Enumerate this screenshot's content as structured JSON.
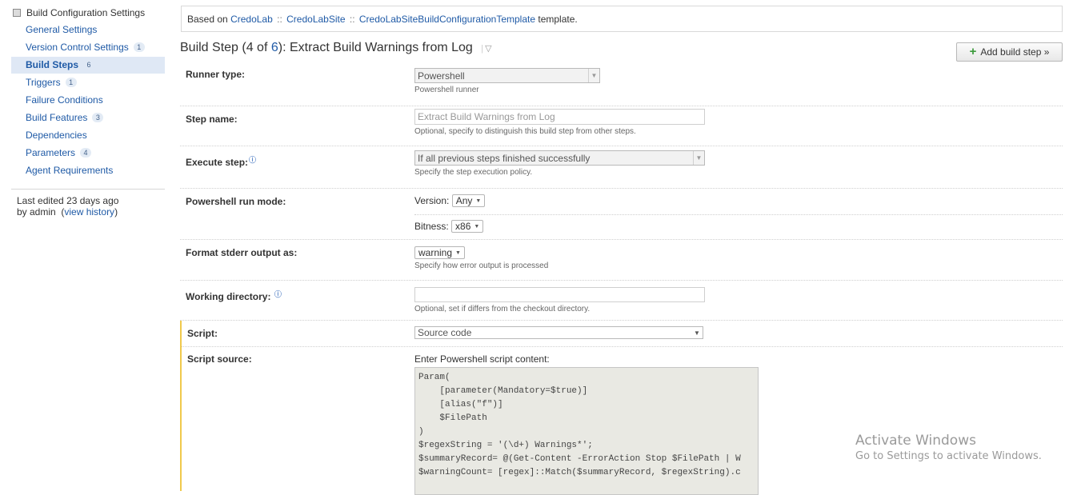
{
  "sidebar": {
    "header": "Build Configuration Settings",
    "items": [
      {
        "label": "General Settings",
        "badge": ""
      },
      {
        "label": "Version Control Settings",
        "badge": "1"
      },
      {
        "label": "Build Steps",
        "badge": "6"
      },
      {
        "label": "Triggers",
        "badge": "1"
      },
      {
        "label": "Failure Conditions",
        "badge": ""
      },
      {
        "label": "Build Features",
        "badge": "3"
      },
      {
        "label": "Dependencies",
        "badge": ""
      },
      {
        "label": "Parameters",
        "badge": "4"
      },
      {
        "label": "Agent Requirements",
        "badge": ""
      }
    ],
    "active_index": 2,
    "last_edited_prefix": "Last edited",
    "last_edited_time": "23 days ago",
    "by_text": "by admin",
    "view_history": "view history"
  },
  "template_banner": {
    "prefix": "Based on",
    "crumbs": [
      "CredoLab",
      "CredoLabSite",
      "CredoLabSiteBuildConfigurationTemplate"
    ],
    "separator": "::",
    "suffix": "template."
  },
  "step_title": {
    "prefix": "Build Step (4 of",
    "total": "6",
    "suffix": "): Extract Build Warnings from Log"
  },
  "add_button": {
    "label": "Add build step »"
  },
  "form": {
    "runner_type": {
      "label": "Runner type:",
      "value": "Powershell",
      "note": "Powershell runner"
    },
    "step_name": {
      "label": "Step name:",
      "value": "Extract Build Warnings from Log",
      "note": "Optional, specify to distinguish this build step from other steps."
    },
    "execute_step": {
      "label": "Execute step:",
      "value": "If all previous steps finished successfully",
      "note": "Specify the step execution policy."
    },
    "run_mode": {
      "label": "Powershell run mode:",
      "version_label": "Version:",
      "version_value": "Any",
      "bitness_label": "Bitness:",
      "bitness_value": "x86"
    },
    "stderr": {
      "label": "Format stderr output as:",
      "value": "warning",
      "note": "Specify how error output is processed"
    },
    "working_dir": {
      "label": "Working directory:",
      "value": "",
      "note": "Optional, set if differs from the checkout directory."
    },
    "script": {
      "label": "Script:",
      "value": "Source code"
    },
    "script_source": {
      "label": "Script source:",
      "caption": "Enter Powershell script content:",
      "code": "Param(\n    [parameter(Mandatory=$true)]\n    [alias(\"f\")]\n    $FilePath\n)\n$regexString = '(\\d+) Warnings*';\n$summaryRecord= @(Get-Content -ErrorAction Stop $FilePath | W\n$warningCount= [regex]::Match($summaryRecord, $regexString).c"
    }
  },
  "watermark": {
    "line1": "Activate Windows",
    "line2": "Go to Settings to activate Windows."
  }
}
